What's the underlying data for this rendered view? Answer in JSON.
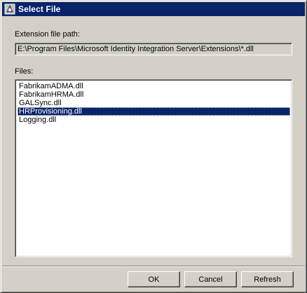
{
  "window": {
    "title": "Select File",
    "icon": "app-icon"
  },
  "extension_path": {
    "label": "Extension file path:",
    "value": "E:\\Program Files\\Microsoft Identity Integration Server\\Extensions\\*.dll"
  },
  "files": {
    "label": "Files:",
    "items": [
      {
        "name": "FabrikamADMA.dll",
        "selected": false
      },
      {
        "name": "FabrikamHRMA.dll",
        "selected": false
      },
      {
        "name": "GALSync.dll",
        "selected": false
      },
      {
        "name": "HRProvisioning.dll",
        "selected": true
      },
      {
        "name": "Logging.dll",
        "selected": false
      }
    ]
  },
  "buttons": {
    "ok": "OK",
    "cancel": "Cancel",
    "refresh": "Refresh"
  },
  "colors": {
    "titlebar": "#0a246a",
    "face": "#d4d0c8",
    "selection": "#0a246a"
  }
}
